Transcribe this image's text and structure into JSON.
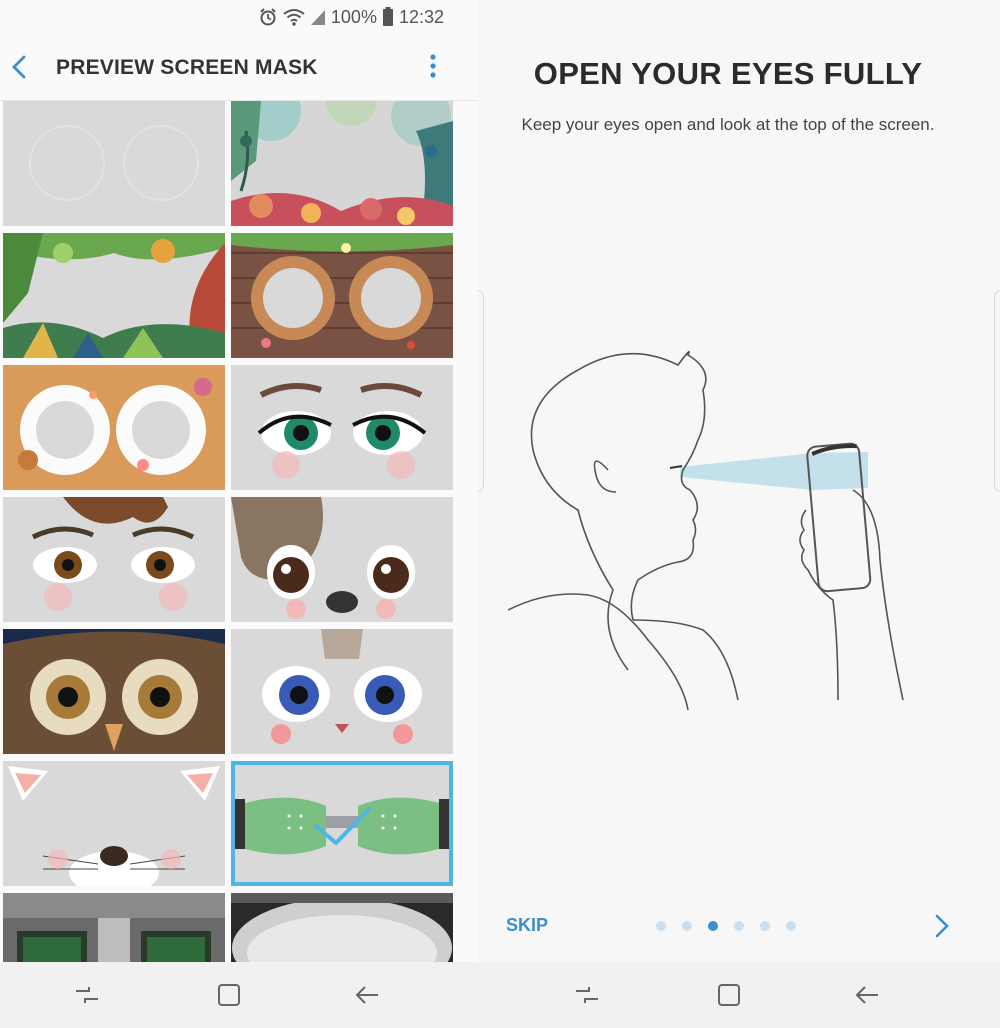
{
  "status_bar": {
    "battery": "100%",
    "time": "12:32",
    "icons": [
      "alarm-icon",
      "wifi-icon",
      "signal-icon",
      "battery-icon"
    ]
  },
  "header": {
    "title": "PREVIEW SCREEN MASK",
    "icons": [
      "back-arrow-icon",
      "more-options-icon"
    ]
  },
  "masks": [
    {
      "name": "none"
    },
    {
      "name": "forest"
    },
    {
      "name": "jungle-leaves"
    },
    {
      "name": "brick-wall"
    },
    {
      "name": "whipped-cream"
    },
    {
      "name": "green-eyes"
    },
    {
      "name": "brown-eyes-hair"
    },
    {
      "name": "puppy"
    },
    {
      "name": "owl"
    },
    {
      "name": "kitten"
    },
    {
      "name": "cat"
    },
    {
      "name": "goggles",
      "selected": true
    },
    {
      "name": "robot"
    },
    {
      "name": "astronaut"
    }
  ],
  "navigation": {
    "icons": [
      "recent-apps-icon",
      "home-icon",
      "back-icon"
    ]
  },
  "onboarding": {
    "title": "OPEN YOUR EYES FULLY",
    "subtitle": "Keep your eyes open and look at the top of the screen.",
    "skip": "SKIP",
    "page_index": 3,
    "page_count": 6
  },
  "colors": {
    "accent": "#3a8fd1",
    "selection": "#4fb5e8"
  }
}
